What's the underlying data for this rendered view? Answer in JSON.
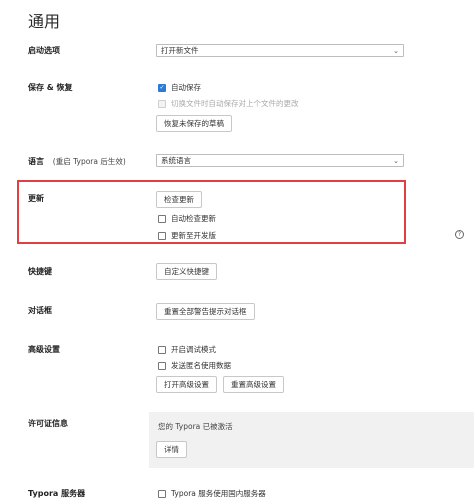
{
  "page": {
    "title": "通用"
  },
  "startup": {
    "label": "启动选项",
    "select_value": "打开新文件"
  },
  "save_restore": {
    "label": "保存 & 恢复",
    "autosave_label": "自动保存",
    "autosave_checked": true,
    "switch_label": "切换文件时自动保存对上个文件的更改",
    "switch_checked": false,
    "switch_disabled": true,
    "recover_button": "恢复未保存的草稿"
  },
  "language": {
    "label": "语言",
    "note": "(重启 Typora 后生效)",
    "select_value": "系统语言"
  },
  "update": {
    "label": "更新",
    "check_button": "检查更新",
    "auto_check_label": "自动检查更新",
    "auto_check_checked": false,
    "dev_label": "更新至开发版",
    "dev_checked": false,
    "help_icon": "?"
  },
  "shortcuts": {
    "label": "快捷键",
    "button": "自定义快捷键"
  },
  "dialogs": {
    "label": "对话框",
    "button": "重置全部警告提示对话框"
  },
  "advanced": {
    "label": "高级设置",
    "debug_label": "开启调试模式",
    "debug_checked": false,
    "anon_label": "发送匿名使用数据",
    "anon_checked": false,
    "open_button": "打开高级设置",
    "reset_button": "重置高级设置"
  },
  "license": {
    "label": "许可证信息",
    "status": "您的 Typora 已被激活",
    "details_button": "详情"
  },
  "typora_server": {
    "label": "Typora 服务器",
    "domestic_label": "Typora 服务使用国内服务器",
    "domestic_checked": false
  },
  "colors": {
    "highlight": "#e04040",
    "checkbox_accent": "#2b7bd6",
    "license_bg": "#f1f1f1"
  }
}
